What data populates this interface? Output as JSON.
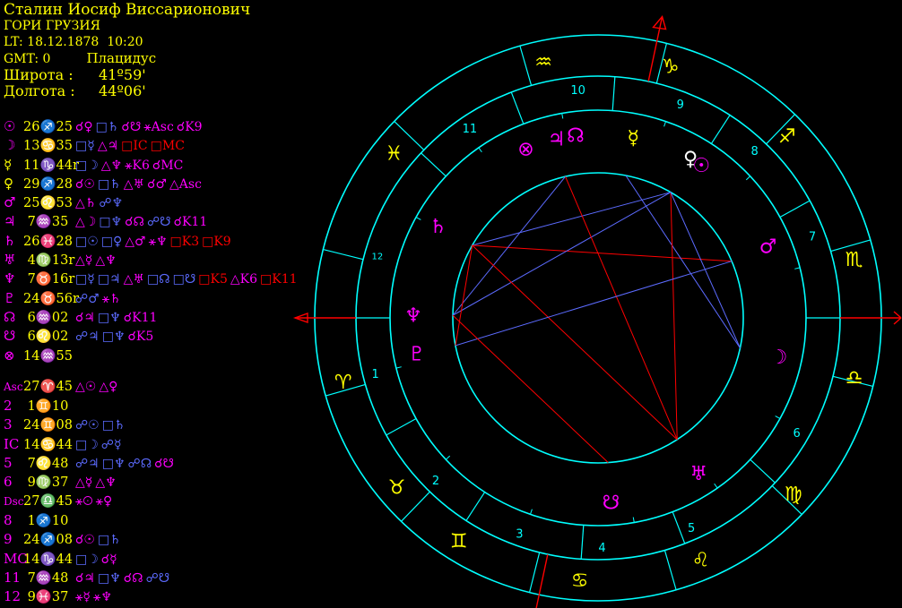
{
  "header": {
    "name": "Сталин Иосиф Виссарионович",
    "place": "ГОРИ ГРУЗИЯ",
    "lt": "LT: 18.12.1878  10:20",
    "gmt": "GMT: 0",
    "system": "Плацидус",
    "lat_label": "Широта :",
    "lat_value": "41º59'",
    "lon_label": "Долгота :",
    "lon_value": "44º06'"
  },
  "colors": {
    "yellow": "#ffff00",
    "magenta": "#ff00ff",
    "cyan": "#00ffff",
    "red": "#ff0000",
    "blue": "#5c6bff"
  },
  "planets": [
    {
      "symbol": "☉",
      "pos": "26♐25",
      "aspects": [
        {
          "t": "☌♀",
          "c": "#ff00ff"
        },
        {
          "t": "□♄",
          "c": "#5c6bff"
        },
        {
          "t": "☌☋",
          "c": "#ff00ff"
        },
        {
          "t": "⚹Asc",
          "c": "#ff00ff"
        },
        {
          "t": "☌K9",
          "c": "#ff00ff"
        }
      ]
    },
    {
      "symbol": "☽",
      "pos": "13♋35",
      "aspects": [
        {
          "t": "□☿",
          "c": "#5c6bff"
        },
        {
          "t": "△♃",
          "c": "#ff00ff"
        },
        {
          "t": "□IC",
          "c": "#ff0000"
        },
        {
          "t": "□MC",
          "c": "#ff0000"
        }
      ]
    },
    {
      "symbol": "☿",
      "pos": "11♑44r",
      "aspects": [
        {
          "t": "□☽",
          "c": "#5c6bff"
        },
        {
          "t": "△♆",
          "c": "#ff00ff"
        },
        {
          "t": "⚹K6",
          "c": "#ff00ff"
        },
        {
          "t": "☌MC",
          "c": "#ff00ff"
        }
      ]
    },
    {
      "symbol": "♀",
      "pos": "29♐28",
      "aspects": [
        {
          "t": "☌☉",
          "c": "#ff00ff"
        },
        {
          "t": "□♄",
          "c": "#5c6bff"
        },
        {
          "t": "△♅",
          "c": "#ff00ff"
        },
        {
          "t": "☌♂",
          "c": "#ff00ff"
        },
        {
          "t": "△Asc",
          "c": "#ff00ff"
        }
      ]
    },
    {
      "symbol": "♂",
      "pos": "25♌53",
      "aspects": [
        {
          "t": "△♄",
          "c": "#ff00ff"
        },
        {
          "t": "☍♆",
          "c": "#5c6bff"
        }
      ]
    },
    {
      "symbol": "♃",
      "pos": " 7♒35",
      "aspects": [
        {
          "t": "△☽",
          "c": "#ff00ff"
        },
        {
          "t": "□♆",
          "c": "#5c6bff"
        },
        {
          "t": "☌☊",
          "c": "#ff00ff"
        },
        {
          "t": "☍☋",
          "c": "#5c6bff"
        },
        {
          "t": "☌K11",
          "c": "#ff00ff"
        }
      ]
    },
    {
      "symbol": "♄",
      "pos": "26♓28",
      "aspects": [
        {
          "t": "□☉",
          "c": "#5c6bff"
        },
        {
          "t": "□♀",
          "c": "#5c6bff"
        },
        {
          "t": "△♂",
          "c": "#ff00ff"
        },
        {
          "t": "⚹♆",
          "c": "#ff00ff"
        },
        {
          "t": "□K3",
          "c": "#ff0000"
        },
        {
          "t": "□K9",
          "c": "#ff0000"
        }
      ]
    },
    {
      "symbol": "♅",
      "pos": " 4♍13r",
      "aspects": [
        {
          "t": "△☿",
          "c": "#ff00ff"
        },
        {
          "t": "△♆",
          "c": "#ff00ff"
        }
      ]
    },
    {
      "symbol": "♆",
      "pos": " 7♉16r",
      "aspects": [
        {
          "t": "□☿",
          "c": "#5c6bff"
        },
        {
          "t": "□♃",
          "c": "#5c6bff"
        },
        {
          "t": "△♅",
          "c": "#ff00ff"
        },
        {
          "t": "□☊",
          "c": "#5c6bff"
        },
        {
          "t": "□☋",
          "c": "#5c6bff"
        },
        {
          "t": "□K5",
          "c": "#ff0000"
        },
        {
          "t": "△K6",
          "c": "#ff00ff"
        },
        {
          "t": "□K11",
          "c": "#ff0000"
        }
      ]
    },
    {
      "symbol": "♇",
      "pos": "24♉56r",
      "aspects": [
        {
          "t": "☍♂",
          "c": "#5c6bff"
        },
        {
          "t": "⚹♄",
          "c": "#ff00ff"
        }
      ]
    },
    {
      "symbol": "☊",
      "pos": " 6♒02",
      "aspects": [
        {
          "t": "☌♃",
          "c": "#ff00ff"
        },
        {
          "t": "□♆",
          "c": "#5c6bff"
        },
        {
          "t": "☌K11",
          "c": "#ff00ff"
        }
      ]
    },
    {
      "symbol": "☋",
      "pos": " 6♌02",
      "aspects": [
        {
          "t": "☍♃",
          "c": "#5c6bff"
        },
        {
          "t": "□♆",
          "c": "#5c6bff"
        },
        {
          "t": "☌K5",
          "c": "#ff00ff"
        }
      ]
    },
    {
      "symbol": "⊗",
      "pos": "14♒55",
      "aspects": []
    }
  ],
  "houses": [
    {
      "label": "Asc",
      "pos": "27♈45",
      "aspects": [
        {
          "t": "△☉",
          "c": "#ff00ff"
        },
        {
          "t": "△♀",
          "c": "#ff00ff"
        }
      ]
    },
    {
      "label": "2",
      "pos": " 1♊10",
      "aspects": []
    },
    {
      "label": "3",
      "pos": "24♊08",
      "aspects": [
        {
          "t": "☍☉",
          "c": "#5c6bff"
        },
        {
          "t": "□♄",
          "c": "#5c6bff"
        }
      ]
    },
    {
      "label": "IC",
      "pos": "14♋44",
      "aspects": [
        {
          "t": "□☽",
          "c": "#5c6bff"
        },
        {
          "t": "☍☿",
          "c": "#5c6bff"
        }
      ]
    },
    {
      "label": "5",
      "pos": " 7♌48",
      "aspects": [
        {
          "t": "☍♃",
          "c": "#5c6bff"
        },
        {
          "t": "□♆",
          "c": "#5c6bff"
        },
        {
          "t": "☍☊",
          "c": "#5c6bff"
        },
        {
          "t": "☌☋",
          "c": "#ff00ff"
        }
      ]
    },
    {
      "label": "6",
      "pos": " 9♍37",
      "aspects": [
        {
          "t": "△☿",
          "c": "#ff00ff"
        },
        {
          "t": "△♆",
          "c": "#ff00ff"
        }
      ]
    },
    {
      "label": "Dsc",
      "pos": "27♎45",
      "aspects": [
        {
          "t": "⚹☉",
          "c": "#ff00ff"
        },
        {
          "t": "⚹♀",
          "c": "#ff00ff"
        }
      ]
    },
    {
      "label": "8",
      "pos": " 1♐10",
      "aspects": []
    },
    {
      "label": "9",
      "pos": "24♐08",
      "aspects": [
        {
          "t": "☌☉",
          "c": "#ff00ff"
        },
        {
          "t": "□♄",
          "c": "#5c6bff"
        }
      ]
    },
    {
      "label": "MC",
      "pos": "14♑44",
      "aspects": [
        {
          "t": "□☽",
          "c": "#5c6bff"
        },
        {
          "t": "☌☿",
          "c": "#ff00ff"
        }
      ]
    },
    {
      "label": "11",
      "pos": " 7♒48",
      "aspects": [
        {
          "t": "☌♃",
          "c": "#ff00ff"
        },
        {
          "t": "□♆",
          "c": "#5c6bff"
        },
        {
          "t": "☌☊",
          "c": "#ff00ff"
        },
        {
          "t": "☍☋",
          "c": "#5c6bff"
        }
      ]
    },
    {
      "label": "12",
      "pos": " 9♓37",
      "aspects": [
        {
          "t": "⚹☿",
          "c": "#ff00ff"
        },
        {
          "t": "⚹♆",
          "c": "#ff00ff"
        }
      ]
    }
  ],
  "chart": {
    "signs": [
      {
        "glyph": "♈",
        "label_angle": 194
      },
      {
        "glyph": "♉",
        "label_angle": 220
      },
      {
        "glyph": "♊",
        "label_angle": 238
      },
      {
        "glyph": "♋",
        "label_angle": 266
      },
      {
        "glyph": "♌",
        "label_angle": 293
      },
      {
        "glyph": "♍",
        "label_angle": 318
      },
      {
        "glyph": "♎",
        "label_angle": 347
      },
      {
        "glyph": "♏",
        "label_angle": 13
      },
      {
        "glyph": "♐",
        "label_angle": 44
      },
      {
        "glyph": "♑",
        "label_angle": 74
      },
      {
        "glyph": "♒",
        "label_angle": 102
      },
      {
        "glyph": "♓",
        "label_angle": 141
      }
    ],
    "house_numbers": [
      {
        "n": "1",
        "angle": 194
      },
      {
        "n": "2",
        "angle": 225
      },
      {
        "n": "3",
        "angle": 250
      },
      {
        "n": "4",
        "angle": 271
      },
      {
        "n": "5",
        "angle": 294
      },
      {
        "n": "6",
        "angle": 330
      },
      {
        "n": "7",
        "angle": 21
      },
      {
        "n": "8",
        "angle": 47
      },
      {
        "n": "9",
        "angle": 69
      },
      {
        "n": "10",
        "angle": 95
      },
      {
        "n": "11",
        "angle": 124
      },
      {
        "n": "12",
        "angle": 164
      }
    ],
    "planet_glyphs": [
      {
        "glyph": "⊗",
        "angle": 113,
        "color": "#ff00ff"
      },
      {
        "glyph": "♃",
        "angle": 103,
        "color": "#ff00ff"
      },
      {
        "glyph": "☊",
        "angle": 97,
        "color": "#ff00ff"
      },
      {
        "glyph": "☿",
        "angle": 79,
        "color": "#ffff00"
      },
      {
        "glyph": "♀",
        "angle": 60,
        "color": "#ffffff"
      },
      {
        "glyph": "☉",
        "angle": 56,
        "color": "#ff00ff"
      },
      {
        "glyph": "♂",
        "angle": 23,
        "color": "#ff00ff"
      },
      {
        "glyph": "☽",
        "angle": 348,
        "color": "#ff00ff"
      },
      {
        "glyph": "♅",
        "angle": 303,
        "color": "#ff00ff"
      },
      {
        "glyph": "☋",
        "angle": 274,
        "color": "#ff00ff"
      },
      {
        "glyph": "♇",
        "angle": 191,
        "color": "#ff00ff"
      },
      {
        "glyph": "♆",
        "angle": 179,
        "color": "#ff00ff"
      },
      {
        "glyph": "♄",
        "angle": 150,
        "color": "#ff00ff"
      }
    ]
  }
}
